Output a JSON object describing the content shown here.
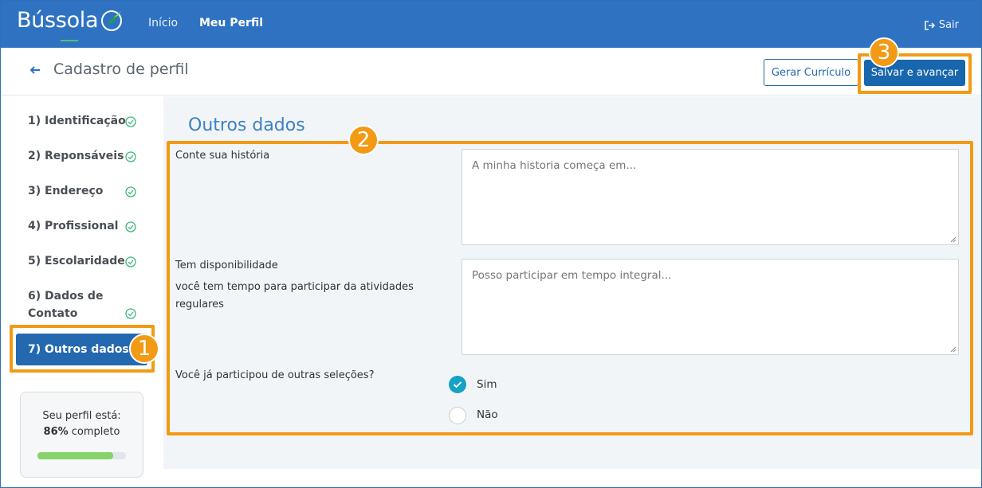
{
  "navbar": {
    "logo": "Bússola",
    "links": [
      {
        "label": "Início"
      },
      {
        "label": "Meu Perfil"
      }
    ],
    "logout": "Sair"
  },
  "header": {
    "title": "Cadastro de perfil",
    "gerar_label": "Gerar Currículo",
    "salvar_label": "Salvar e avançar"
  },
  "sidebar": {
    "steps": [
      {
        "label": "1) Identificação",
        "done": true
      },
      {
        "label": "2) Reponsáveis",
        "done": true
      },
      {
        "label": "3) Endereço",
        "done": true
      },
      {
        "label": "4) Profissional",
        "done": true
      },
      {
        "label": "5) Escolaridade",
        "done": true
      },
      {
        "label": "6) Dados de",
        "label2": "Contato",
        "done": true
      },
      {
        "label": "7) Outros dados",
        "active": true
      }
    ],
    "progress": {
      "line1": "Seu perfil está:",
      "percent_text": "86%",
      "suffix": " completo",
      "value": 0.86
    }
  },
  "main": {
    "section_title": "Outros dados",
    "fields": [
      {
        "label": "Conte sua história",
        "placeholder": "A minha historia começa em..."
      },
      {
        "label": "Tem disponibilidade",
        "sublabel_1": "você tem tempo para participar da atividades",
        "sublabel_2": "regulares",
        "placeholder": "Posso participar em tempo integral..."
      }
    ],
    "question": {
      "label": "Você já participou de outras seleções?",
      "options": [
        {
          "label": "Sim",
          "selected": true
        },
        {
          "label": "Não",
          "selected": false
        }
      ]
    }
  },
  "annotations": [
    "1",
    "2",
    "3"
  ],
  "colors": {
    "navbar": "#2f72c2",
    "primary": "#1866ad",
    "highlight": "#f39a15",
    "check": "#3cb878",
    "radio_selected": "#17a2c4",
    "progress": "#85d36a"
  }
}
